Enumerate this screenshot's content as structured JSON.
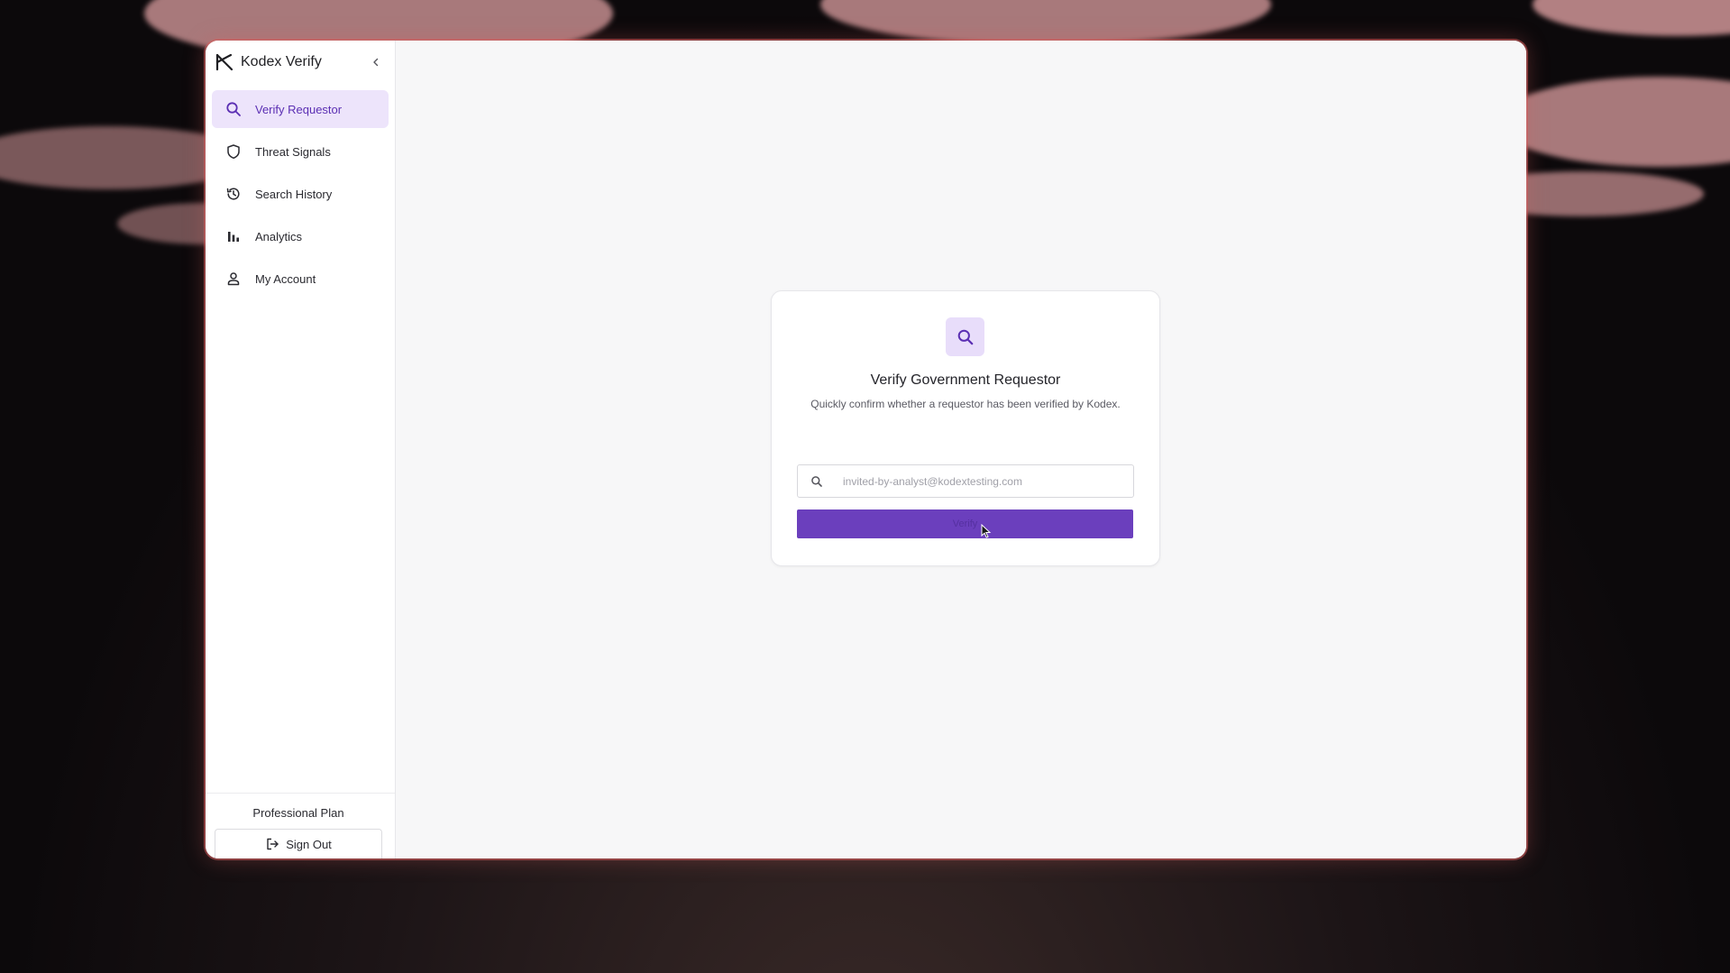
{
  "app": {
    "name": "Kodex Verify"
  },
  "sidebar": {
    "collapse_icon": "chevron-left-icon",
    "items": [
      {
        "label": "Verify Requestor",
        "icon": "search-icon",
        "active": true
      },
      {
        "label": "Threat Signals",
        "icon": "shield-icon",
        "active": false
      },
      {
        "label": "Search History",
        "icon": "history-icon",
        "active": false
      },
      {
        "label": "Analytics",
        "icon": "bar-chart-icon",
        "active": false
      },
      {
        "label": "My Account",
        "icon": "user-icon",
        "active": false
      }
    ],
    "plan_label": "Professional Plan",
    "sign_out_label": "Sign Out",
    "sign_out_icon": "sign-out-icon"
  },
  "card": {
    "icon": "search-icon",
    "title": "Verify Government Requestor",
    "subtitle": "Quickly confirm whether a requestor has been verified by Kodex.",
    "search": {
      "value": "",
      "placeholder": "invited-by-analyst@kodextesting.com",
      "icon": "search-icon"
    },
    "verify_button_label": "Verify"
  },
  "colors": {
    "accent": "#6b3fbd",
    "accent_light": "#ede4fb",
    "active_text": "#5b2fb3"
  }
}
